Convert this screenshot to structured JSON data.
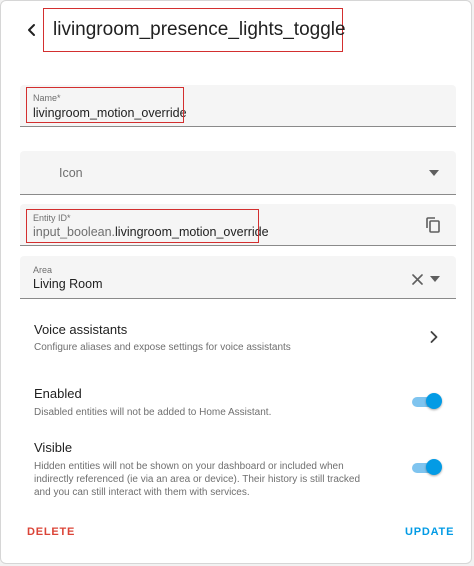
{
  "header": {
    "back_icon": "arrow-left-icon",
    "title": "livingroom_presence_lights_toggle"
  },
  "form": {
    "name": {
      "label": "Name*",
      "value": "livingroom_motion_override"
    },
    "icon": {
      "placeholder": "Icon",
      "dropdown_icon": "chevron-down-icon"
    },
    "entity_id": {
      "label": "Entity ID*",
      "prefix": "input_boolean.",
      "value": "livingroom_motion_override",
      "copy_icon": "copy-icon"
    },
    "area": {
      "label": "Area",
      "value": "Living Room",
      "clear_icon": "close-icon",
      "dropdown_icon": "chevron-down-icon"
    }
  },
  "voice_assistants": {
    "title": "Voice assistants",
    "description": "Configure aliases and expose settings for voice assistants",
    "icon": "chevron-right-icon"
  },
  "enabled": {
    "title": "Enabled",
    "description": "Disabled entities will not be added to Home Assistant.",
    "on": true
  },
  "visible": {
    "title": "Visible",
    "description_lines": [
      "Hidden entities will not be shown on your dashboard or included when",
      "indirectly referenced (ie via an area or device). Their history is still tracked",
      "and you can still interact with them with services."
    ],
    "on": true
  },
  "actions": {
    "delete_label": "DELETE",
    "update_label": "UPDATE"
  },
  "colors": {
    "accent": "#039be5",
    "danger": "#db4437",
    "highlight_box": "#d32f2f"
  }
}
